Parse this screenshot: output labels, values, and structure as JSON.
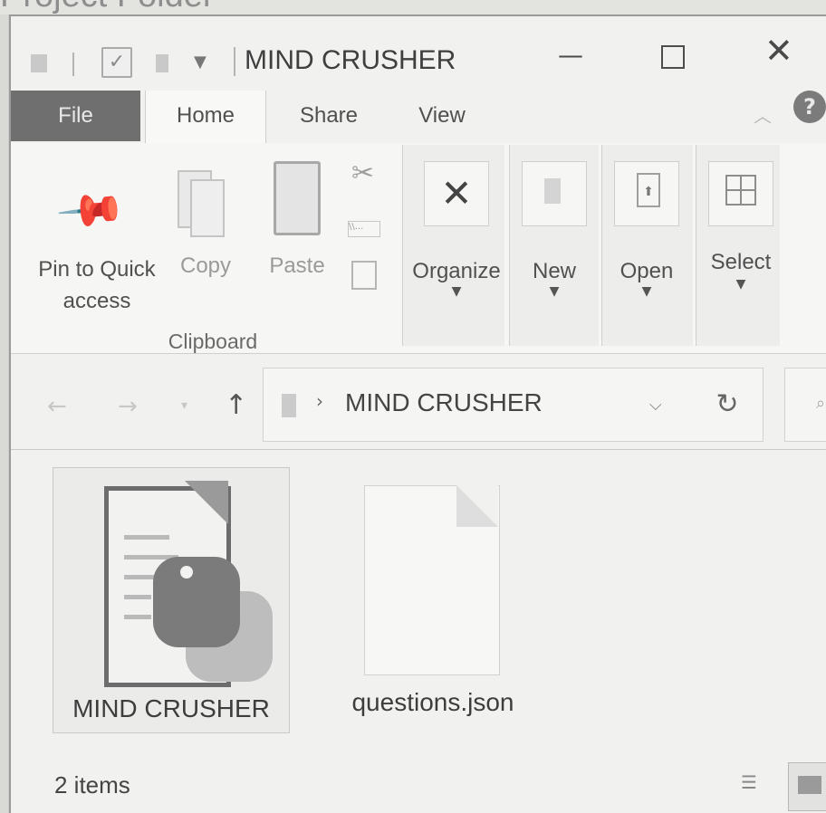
{
  "partial_title": "Project Folder",
  "window": {
    "title": "MIND CRUSHER",
    "controls": {
      "minimize": "—",
      "maximize": "",
      "close": "✕"
    }
  },
  "ribbon": {
    "tabs": [
      {
        "label": "File"
      },
      {
        "label": "Home"
      },
      {
        "label": "Share"
      },
      {
        "label": "View"
      }
    ],
    "help": "?",
    "clipboard": {
      "pin_label": "Pin to Quick access",
      "copy_label": "Copy",
      "paste_label": "Paste",
      "copy_path_glyph": "\\\\...",
      "group_label": "Clipboard"
    },
    "organize_label": "Organize",
    "new_label": "New",
    "open_label": "Open",
    "select_label": "Select"
  },
  "address": {
    "path": "MIND CRUSHER"
  },
  "files": [
    {
      "name": "MIND CRUSHER",
      "icon": "python-file-icon",
      "selected": true
    },
    {
      "name": "questions.json",
      "icon": "blank-file-icon",
      "selected": false
    }
  ],
  "status": {
    "items_text": "2 items"
  }
}
